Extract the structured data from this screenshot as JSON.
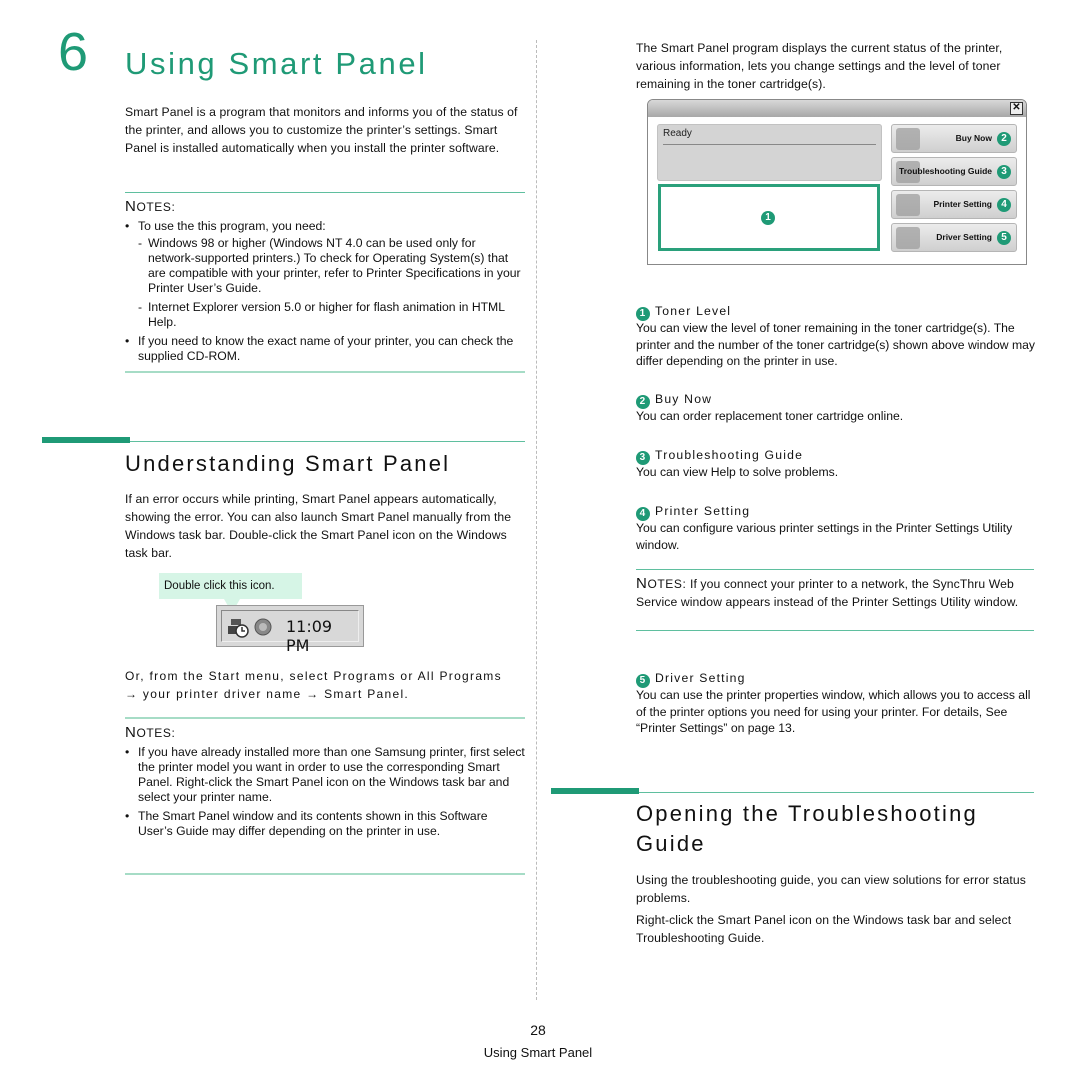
{
  "chapter": {
    "number": "6",
    "title": "Using Smart Panel",
    "intro": "Smart Panel is a program that monitors and informs you of the status of the printer, and allows you to customize the printer’s settings. Smart Panel is installed automatically when you install the printer software."
  },
  "notes1": {
    "heading_cap": "N",
    "heading_rest": "OTES:",
    "items": [
      {
        "text": "To use the this program, you need:",
        "sub": [
          "Windows 98 or higher (Windows NT 4.0 can be used only for network-supported printers.) To check for Operating System(s) that are compatible with your printer, refer to Printer Specifications in your Printer User’s Guide.",
          "Internet Explorer version 5.0 or higher for flash animation in HTML Help."
        ]
      },
      {
        "text": "If you need to know the exact name of your printer, you can check the supplied CD-ROM."
      }
    ]
  },
  "understanding": {
    "title": "Understanding Smart Panel",
    "body": "If an error occurs while printing, Smart Panel appears automatically, showing the error. You can also launch Smart Panel manually from the Windows task bar. Double-click the Smart Panel icon on the Windows task bar.",
    "tooltip": "Double click this icon.",
    "clock": "11:09 PM",
    "start_menu_line1": "Or, from the Start menu, select Programs or All Programs",
    "start_menu_line2": "→ your printer driver name → Smart Panel."
  },
  "notes2": {
    "heading_cap": "N",
    "heading_rest": "OTES:",
    "items": [
      "If you have already installed more than one Samsung printer, first select the printer model you want in order to use the corresponding Smart Panel. Right-click the Smart Panel icon on the Windows task bar and select your printer name.",
      "The Smart Panel window and its contents shown in this Software User’s Guide may differ depending on the printer in use."
    ]
  },
  "right_intro": "The Smart Panel program displays the current status of the printer, various information, lets you change settings and the level of toner remaining in the toner cartridge(s).",
  "smart_panel_window": {
    "close": "✕",
    "status": "Ready",
    "toner_badge": "1",
    "buttons": [
      {
        "label": "Buy Now",
        "badge": "2"
      },
      {
        "label": "Troubleshooting Guide",
        "badge": "3"
      },
      {
        "label": "Printer Setting",
        "badge": "4"
      },
      {
        "label": "Driver Setting",
        "badge": "5"
      }
    ]
  },
  "items": [
    {
      "badge": "1",
      "title": "Toner Level",
      "body": "You can view the level of toner remaining in the toner cartridge(s). The printer and the number of the toner cartridge(s) shown above window may differ depending on the printer in use."
    },
    {
      "badge": "2",
      "title": "Buy Now",
      "body": "You can order replacement toner cartridge online."
    },
    {
      "badge": "3",
      "title": "Troubleshooting Guide",
      "body": "You can view Help to solve problems."
    },
    {
      "badge": "4",
      "title": "Printer Setting",
      "body": "You can configure various printer settings in the Printer Settings Utility window."
    },
    {
      "badge": "5",
      "title": "Driver Setting",
      "body": "You can use the printer properties window, which allows you to access all of the printer options you need for using your printer. For details, See “Printer Settings” on page 13."
    }
  ],
  "notes3": {
    "heading_cap": "N",
    "heading_rest": "OTES:",
    "text": "If you connect your printer to a network, the SyncThru Web Service window appears instead of the Printer Settings Utility window."
  },
  "opening": {
    "title": "Opening the Troubleshooting Guide",
    "para1": "Using the troubleshooting guide, you can view solutions for error status problems.",
    "para2": "Right-click the Smart Panel icon on the Windows task bar and select Troubleshooting Guide."
  },
  "footer": {
    "page": "28",
    "title": "Using Smart Panel"
  },
  "colors": {
    "accent": "#1f9a76",
    "rule": "#5fbf9f",
    "tooltip": "#d6f5e6"
  }
}
